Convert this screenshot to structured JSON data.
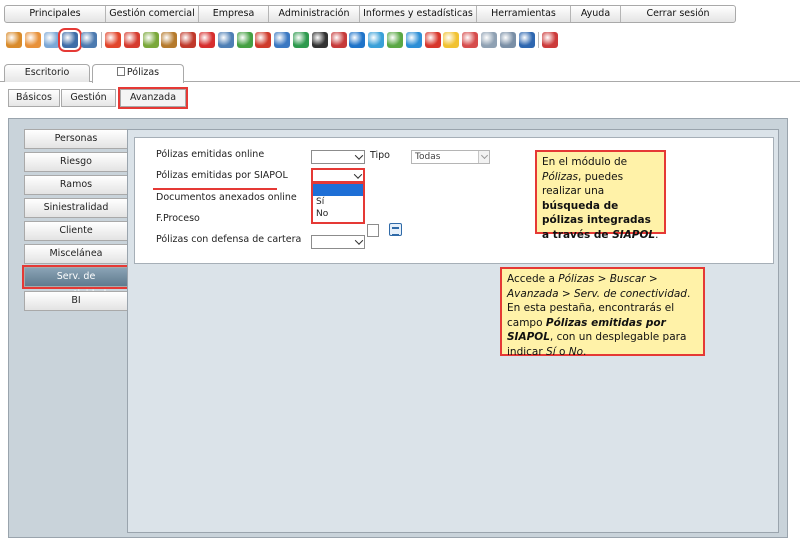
{
  "menu": [
    {
      "label": "Principales",
      "w": 101
    },
    {
      "label": "Gestión comercial",
      "w": 93
    },
    {
      "label": "Empresa",
      "w": 70
    },
    {
      "label": "Administración",
      "w": 91
    },
    {
      "label": "Informes y estadísticas",
      "w": 117
    },
    {
      "label": "Herramientas",
      "w": 94
    },
    {
      "label": "Ayuda",
      "w": 50
    },
    {
      "label": "Cerrar sesión",
      "w": 114
    }
  ],
  "toolbar": {
    "icons": [
      {
        "name": "package-icon",
        "color": "#d98b2b"
      },
      {
        "name": "user-orange-icon",
        "color": "#e8913a"
      },
      {
        "name": "user-group-icon",
        "color": "#7ba7d6"
      },
      {
        "name": "policies-icon",
        "color": "#3f6ea8",
        "selected": true
      },
      {
        "name": "monitor-icon",
        "color": "#4c7ab0"
      },
      {
        "name": "fire-icon",
        "color": "#e2452b"
      },
      {
        "name": "target-icon",
        "color": "#d63b2f"
      },
      {
        "name": "pencil-icon",
        "color": "#7aa83a"
      },
      {
        "name": "briefcase-icon",
        "color": "#b57a2c"
      },
      {
        "name": "medical-case-icon",
        "color": "#c0392b"
      },
      {
        "name": "red-m-icon",
        "color": "#d62e2e"
      },
      {
        "name": "mail-icon",
        "color": "#4e7fb5"
      },
      {
        "name": "battery-icon",
        "color": "#45a043"
      },
      {
        "name": "person-red-icon",
        "color": "#cf3b2c"
      },
      {
        "name": "person-blue-icon",
        "color": "#3a78c2"
      },
      {
        "name": "money-icon",
        "color": "#2e9a4e"
      },
      {
        "name": "globe-dark-icon",
        "color": "#333333"
      },
      {
        "name": "network-icon",
        "color": "#c63a3a"
      },
      {
        "name": "blue-circle-icon",
        "color": "#1e73c9"
      },
      {
        "name": "diamond-icon",
        "color": "#3aa0d8"
      },
      {
        "name": "green-arrows-icon",
        "color": "#5aa845"
      },
      {
        "name": "refresh-icon",
        "color": "#2d8fd6"
      },
      {
        "name": "google-icon",
        "color": "#d8362b"
      },
      {
        "name": "bulb-icon",
        "color": "#f1c232"
      },
      {
        "name": "form-icon",
        "color": "#d64c4c"
      },
      {
        "name": "notes-icon",
        "color": "#8fa1b3"
      },
      {
        "name": "search-doc-icon",
        "color": "#7a8fa6"
      },
      {
        "name": "phone-icon",
        "color": "#2e67b0"
      },
      {
        "name": "help-icon",
        "color": "#cc3b3b"
      }
    ]
  },
  "page_tabs": [
    {
      "label": "Escritorio",
      "active": false
    },
    {
      "label": "Pólizas",
      "active": true
    }
  ],
  "sub_tabs": [
    {
      "label": "Básicos",
      "active": false
    },
    {
      "label": "Gestión",
      "active": false
    },
    {
      "label": "Avanzada",
      "active": true
    }
  ],
  "sidebar": {
    "items": [
      {
        "label": "Personas",
        "active": false
      },
      {
        "label": "Riesgo",
        "active": false
      },
      {
        "label": "Ramos",
        "active": false
      },
      {
        "label": "Siniestralidad",
        "active": false
      },
      {
        "label": "Cliente",
        "active": false
      },
      {
        "label": "Miscelánea",
        "active": false
      },
      {
        "label": "Serv. de conectividad",
        "active": true
      },
      {
        "label": "BI",
        "active": false
      }
    ]
  },
  "form": {
    "emitidas_online_label": "Pólizas emitidas online",
    "tipo_label": "Tipo",
    "tipo_value": "Todas",
    "siapol_label": "Pólizas emitidas por SIAPOL",
    "siapol_value": "",
    "siapol_options": [
      "",
      "Sí",
      "No"
    ],
    "anexados_label": "Documentos anexados online",
    "fproceso_label": "F.Proceso",
    "defensa_label": "Pólizas con defensa de cartera"
  },
  "callout1": {
    "p1": "En el módulo de ",
    "p2": "Pólizas",
    "p3": ", puedes realizar una ",
    "p4": "búsqueda de pólizas integradas a través de ",
    "p5": "SIAPOL",
    "p6": "."
  },
  "callout2": {
    "p1": "Accede a ",
    "p2": "Pólizas > Buscar > Avanzada > Serv. de conectividad",
    "p3": ". En esta pestaña, encontrarás el campo ",
    "p4": "Pólizas emitidas por SIAPOL",
    "p5": ", con un desplegable para indicar ",
    "p6": "Sí",
    "p7": " o ",
    "p8": "No",
    "p9": "."
  }
}
